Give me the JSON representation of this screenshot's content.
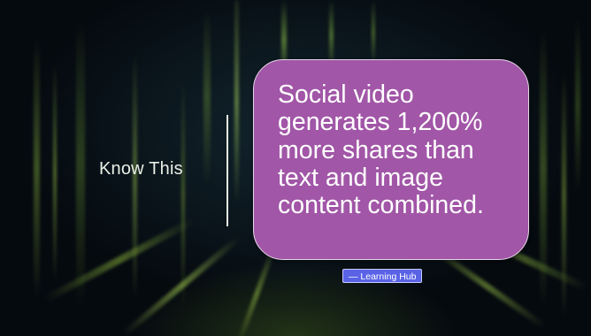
{
  "slide": {
    "heading": "Know This",
    "callout_text": "Social video generates 1,200% more shares than text and image content combined.",
    "source_badge": "— Learning Hub"
  },
  "colors": {
    "background": "#05090c",
    "callout_fill": "#a156a7",
    "callout_border": "#e7d6ea",
    "badge_fill": "#5a63e6",
    "heading_text": "#e9efe6",
    "divider": "#e8ede4",
    "streak_green": "#7fb23a"
  }
}
